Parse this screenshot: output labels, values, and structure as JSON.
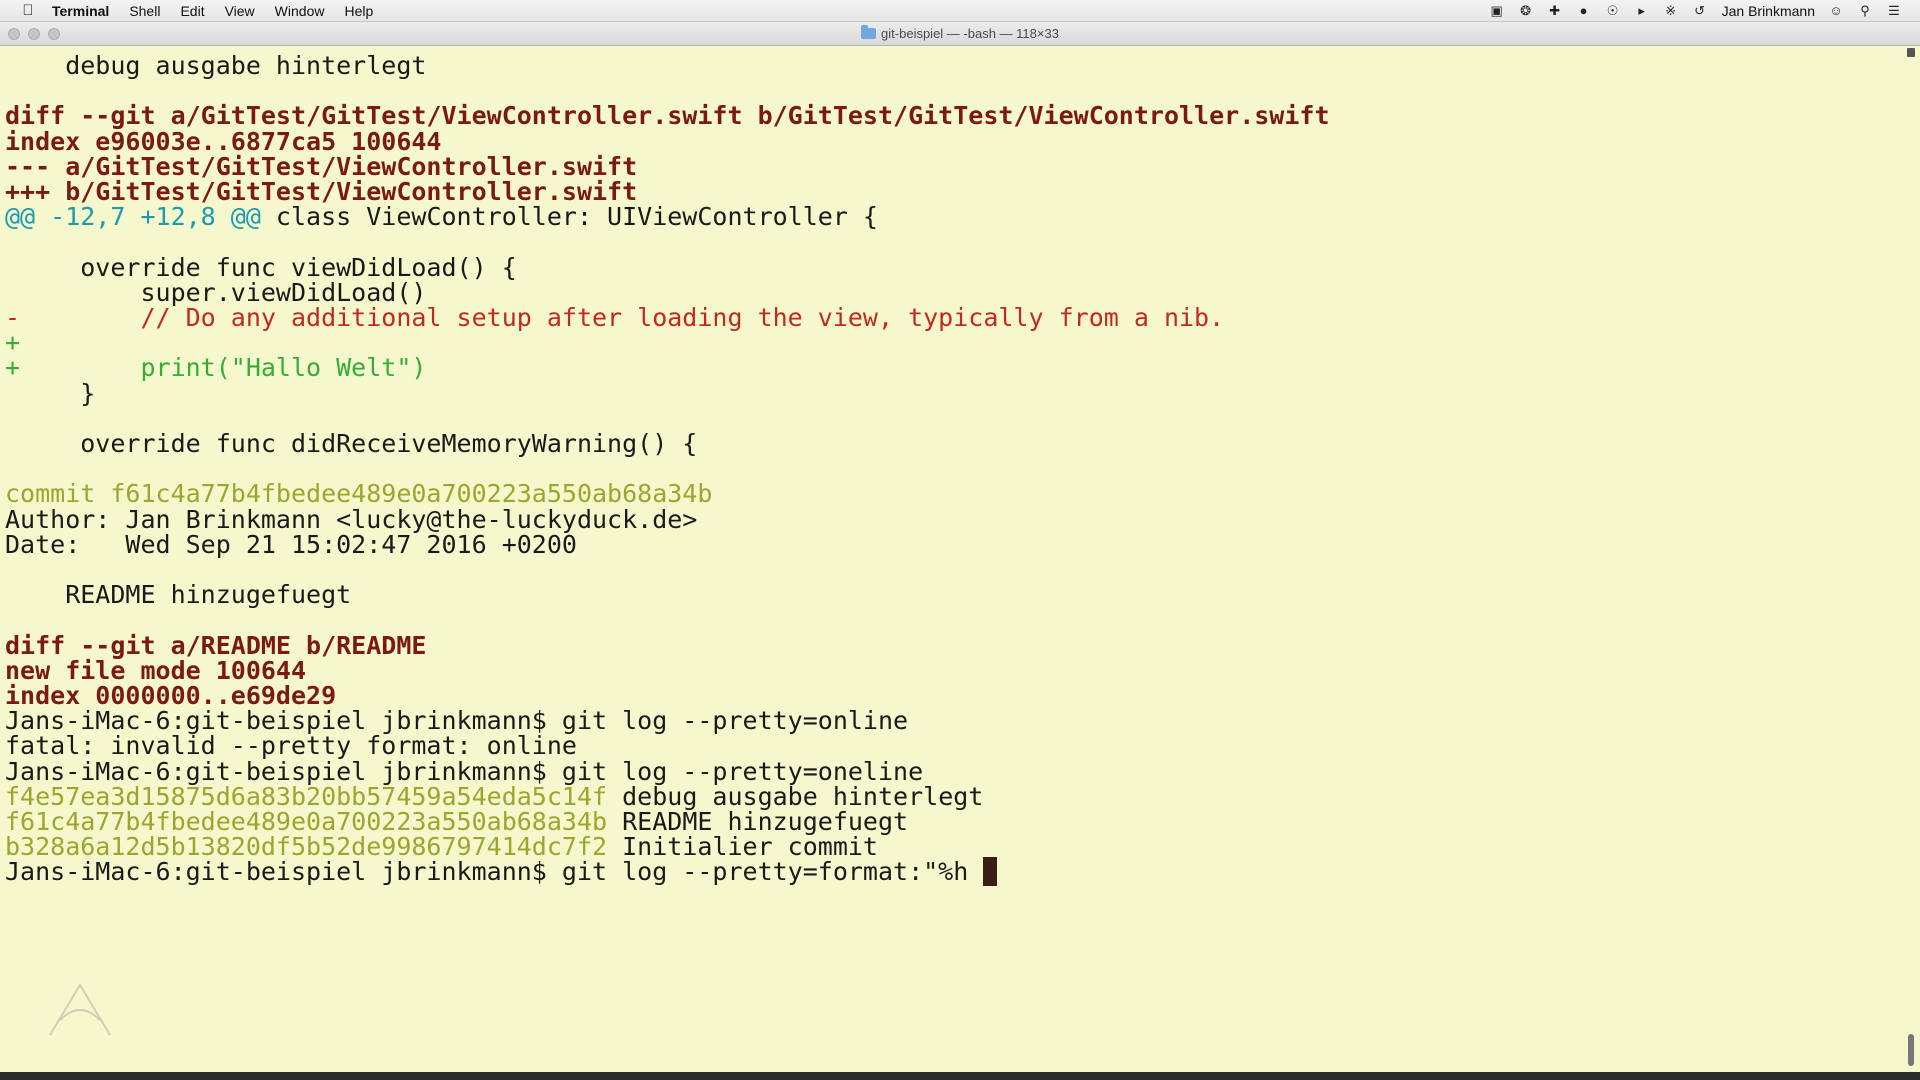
{
  "menubar": {
    "apple_icon": "apple-logo-icon",
    "app_name": "Terminal",
    "items": [
      "Shell",
      "Edit",
      "View",
      "Window",
      "Help"
    ],
    "status_icons": [
      "screen-record-icon",
      "app-icon-1",
      "app-icon-2",
      "app-icon-3",
      "app-icon-4",
      "volume-icon",
      "bluetooth-icon",
      "time-machine-icon"
    ],
    "user_name": "Jan Brinkmann",
    "right_icons": [
      "user-icon",
      "spotlight-search-icon",
      "notification-center-icon"
    ]
  },
  "window": {
    "title": "git-beispiel — -bash — 118×33"
  },
  "terminal": {
    "lines": [
      {
        "text": "    debug ausgabe hinterlegt",
        "style": "plain"
      },
      {
        "text": "",
        "style": "plain"
      },
      {
        "text": "diff --git a/GitTest/GitTest/ViewController.swift b/GitTest/GitTest/ViewController.swift",
        "style": "diff"
      },
      {
        "text": "index e96003e..6877ca5 100644",
        "style": "diff"
      },
      {
        "text": "--- a/GitTest/GitTest/ViewController.swift",
        "style": "diff"
      },
      {
        "text": "+++ b/GitTest/GitTest/ViewController.swift",
        "style": "diff"
      },
      {
        "text": "",
        "style": "hunk",
        "hunk": "@@ -12,7 +12,8 @@",
        "rest": " class ViewController: UIViewController {"
      },
      {
        "text": "",
        "style": "plain"
      },
      {
        "text": "     override func viewDidLoad() {",
        "style": "plain"
      },
      {
        "text": "         super.viewDidLoad()",
        "style": "plain"
      },
      {
        "text": "-        // Do any additional setup after loading the view, typically from a nib.",
        "style": "del"
      },
      {
        "text": "+",
        "style": "add"
      },
      {
        "text": "+        print(\"Hallo Welt\")",
        "style": "add"
      },
      {
        "text": "     }",
        "style": "plain"
      },
      {
        "text": "",
        "style": "plain"
      },
      {
        "text": "     override func didReceiveMemoryWarning() {",
        "style": "plain"
      },
      {
        "text": "",
        "style": "plain"
      },
      {
        "text": "commit f61c4a77b4fbedee489e0a700223a550ab68a34b",
        "style": "hash"
      },
      {
        "text": "Author: Jan Brinkmann <lucky@the-luckyduck.de>",
        "style": "plain"
      },
      {
        "text": "Date:   Wed Sep 21 15:02:47 2016 +0200",
        "style": "plain"
      },
      {
        "text": "",
        "style": "plain"
      },
      {
        "text": "    README hinzugefuegt",
        "style": "plain"
      },
      {
        "text": "",
        "style": "plain"
      },
      {
        "text": "diff --git a/README b/README",
        "style": "diff"
      },
      {
        "text": "new file mode 100644",
        "style": "diff"
      },
      {
        "text": "index 0000000..e69de29",
        "style": "diff"
      },
      {
        "text": "Jans-iMac-6:git-beispiel jbrinkmann$ git log --pretty=online",
        "style": "plain"
      },
      {
        "text": "fatal: invalid --pretty format: online",
        "style": "plain"
      },
      {
        "text": "Jans-iMac-6:git-beispiel jbrinkmann$ git log --pretty=oneline",
        "style": "plain"
      },
      {
        "text": "",
        "style": "oneline",
        "hash": "f4e57ea3d15875d6a83b20bb57459a54eda5c14f",
        "rest": " debug ausgabe hinterlegt"
      },
      {
        "text": "",
        "style": "oneline",
        "hash": "f61c4a77b4fbedee489e0a700223a550ab68a34b",
        "rest": " README hinzugefuegt"
      },
      {
        "text": "",
        "style": "oneline",
        "hash": "b328a6a12d5b13820df5b52de9986797414dc7f2",
        "rest": " Initialier commit"
      },
      {
        "text": "Jans-iMac-6:git-beispiel jbrinkmann$ git log --pretty=format:\"%h ",
        "style": "prompt",
        "cursor_char": "\""
      }
    ]
  }
}
